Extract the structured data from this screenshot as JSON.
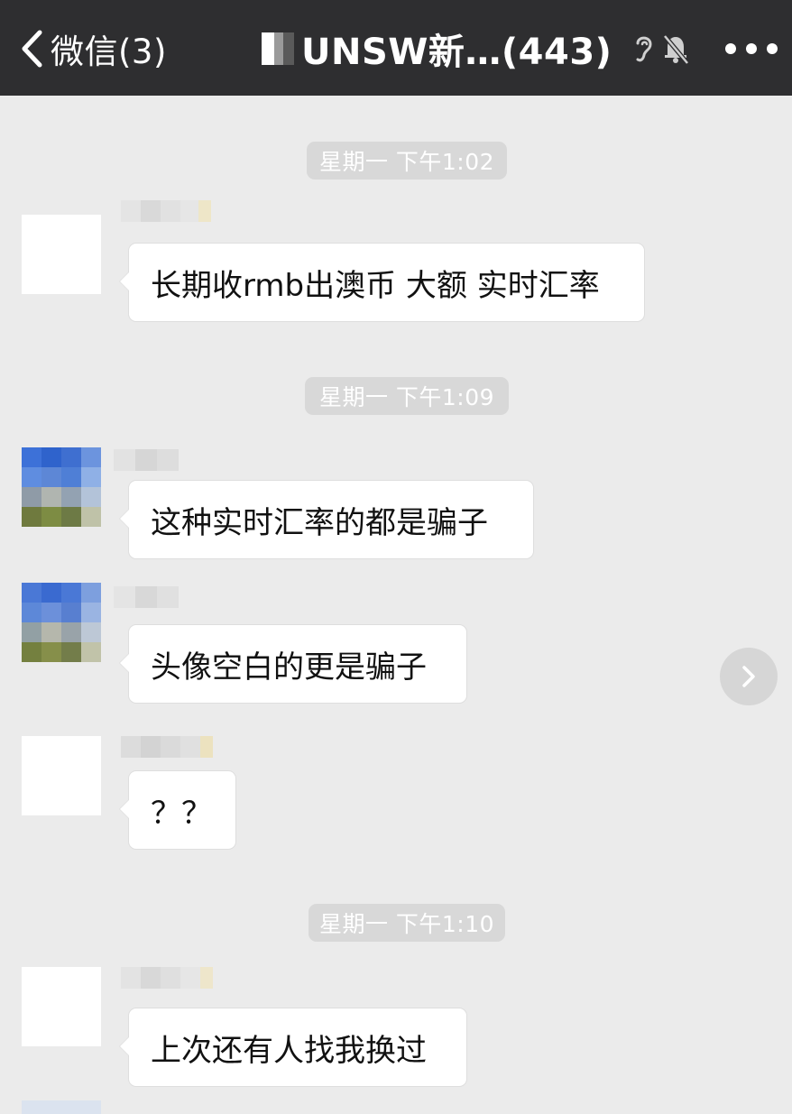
{
  "nav": {
    "back_label": "微信(3)",
    "title": "UNSW新…(443)",
    "icons": [
      "chevron-left-icon",
      "ear-icon",
      "muted-bell-icon",
      "more-icon"
    ]
  },
  "messages": [
    {
      "time": "星期一 下午1:02",
      "text": "长期收rmb出澳币 大额 实时汇率"
    },
    {
      "time": "星期一 下午1:09",
      "text": "这种实时汇率的都是骗子"
    },
    {
      "time": "",
      "text": "头像空白的更是骗子"
    },
    {
      "time": "",
      "text": "？？"
    },
    {
      "time": "星期一 下午1:10",
      "text": "上次还有人找我换过"
    }
  ],
  "colors": {
    "navbar": "#2e2e30",
    "background": "#ebebeb",
    "bubble": "#ffffff",
    "timestamp_bg": "#d8d8d8"
  }
}
